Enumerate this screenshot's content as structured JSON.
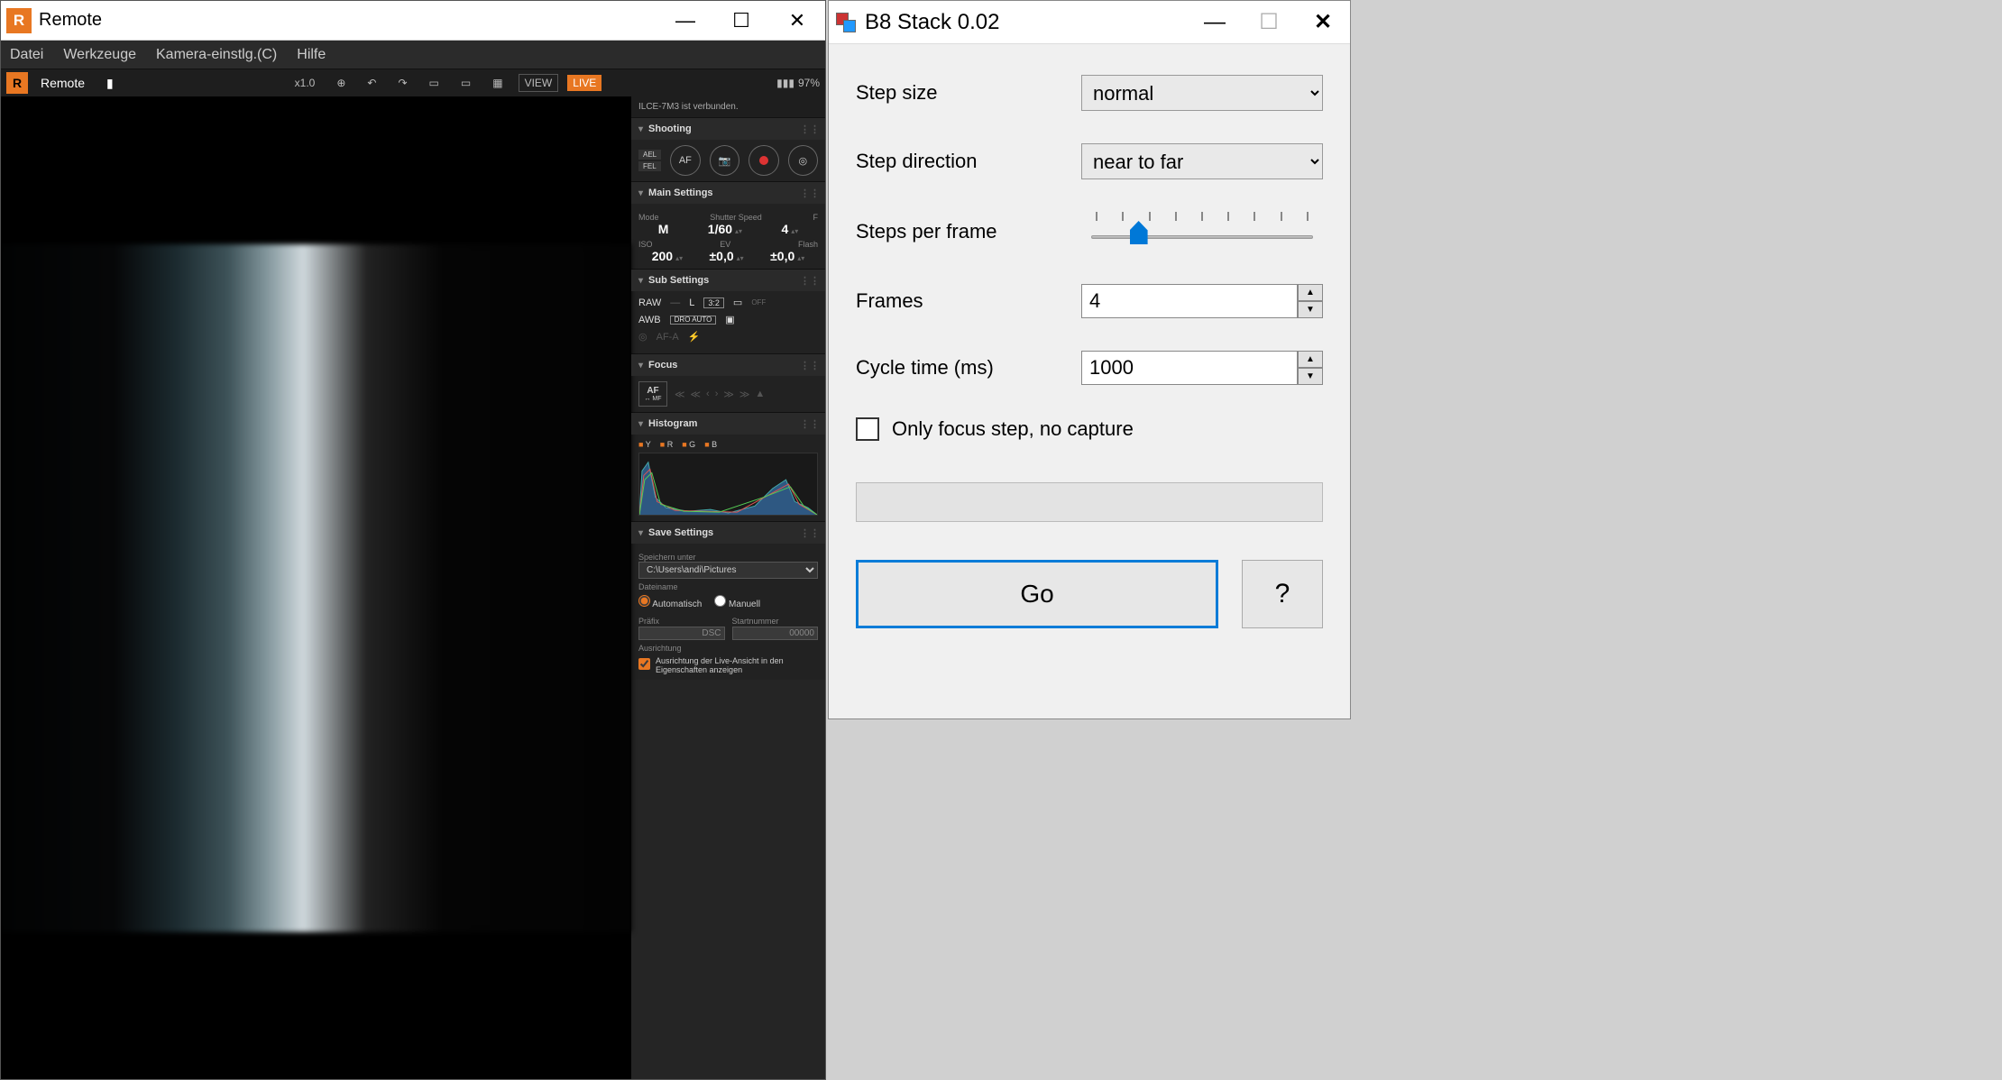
{
  "remote": {
    "title": "Remote",
    "menus": {
      "file": "Datei",
      "tools": "Werkzeuge",
      "camera": "Kamera-einstlg.(C)",
      "help": "Hilfe"
    },
    "toolbar": {
      "zoom": "x1.0",
      "view": "VIEW",
      "live": "LIVE",
      "battery": "97%"
    },
    "status": "ILCE-7M3 ist verbunden.",
    "sections": {
      "shooting": {
        "title": "Shooting",
        "ael": "AEL",
        "fel": "FEL",
        "af": "AF"
      },
      "main": {
        "title": "Main Settings",
        "labels": {
          "mode": "Mode",
          "shutter": "Shutter Speed",
          "f": "F",
          "iso": "ISO",
          "ev": "EV",
          "flash": "Flash"
        },
        "values": {
          "mode": "M",
          "shutter": "1/60",
          "f": "4",
          "iso": "200",
          "ev": "±0,0",
          "flash": "±0,0"
        }
      },
      "sub": {
        "title": "Sub Settings",
        "raw": "RAW",
        "size": "L",
        "ratio": "3:2",
        "awb": "AWB",
        "dro": "DRO AUTO",
        "off": "OFF"
      },
      "focus": {
        "title": "Focus",
        "mode": "AF",
        "sub": "↔ MF"
      },
      "histogram": {
        "title": "Histogram",
        "y": "Y",
        "r": "R",
        "g": "G",
        "b": "B"
      },
      "save": {
        "title": "Save Settings",
        "save_under": "Speichern unter",
        "path": "C:\\Users\\andi\\Pictures",
        "filename": "Dateiname",
        "auto": "Automatisch",
        "manual": "Manuell",
        "prefix": "Präfix",
        "prefix_val": "DSC",
        "startnum": "Startnummer",
        "startnum_val": "00000",
        "orient": "Ausrichtung",
        "orient_chk": "Ausrichtung der Live-Ansicht in den Eigenschaften anzeigen"
      }
    }
  },
  "stack": {
    "title": "B8 Stack 0.02",
    "labels": {
      "step_size": "Step size",
      "step_dir": "Step direction",
      "steps_per_frame": "Steps per frame",
      "frames": "Frames",
      "cycle": "Cycle time (ms)",
      "only_focus": "Only focus step, no capture",
      "go": "Go",
      "help": "?"
    },
    "values": {
      "step_size": "normal",
      "step_dir": "near to far",
      "frames": "4",
      "cycle": "1000"
    }
  }
}
